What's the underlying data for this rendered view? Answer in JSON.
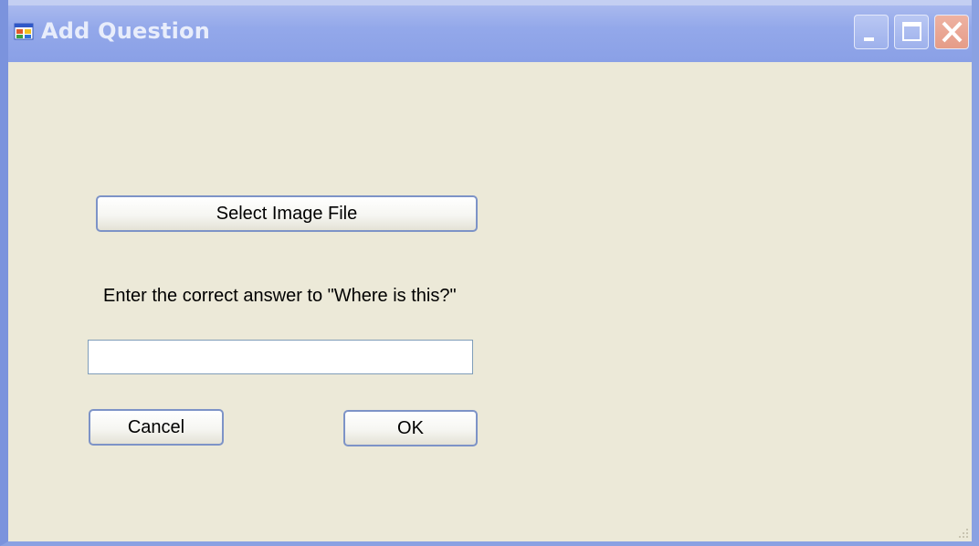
{
  "window": {
    "title": "Add Question",
    "controls": {
      "minimize": "minimize-icon",
      "maximize": "maximize-icon",
      "close": "close-icon"
    }
  },
  "form": {
    "select_image_label": "Select Image File",
    "prompt_text": "Enter the correct answer to \"Where is this?\"",
    "answer_value": "",
    "cancel_label": "Cancel",
    "ok_label": "OK"
  },
  "colors": {
    "titlebar": "#93a8ea",
    "client_bg": "#ece9d8",
    "button_border": "#7d93c7",
    "close_button": "#e59c88"
  }
}
